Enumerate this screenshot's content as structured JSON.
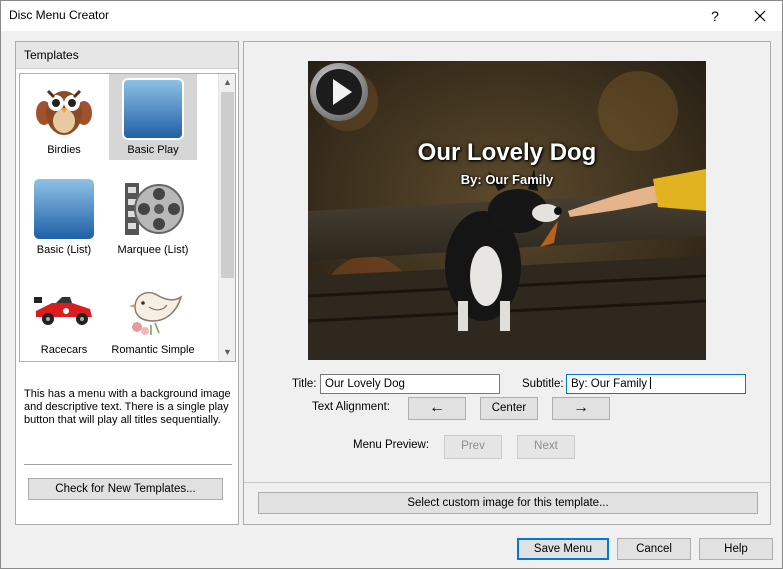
{
  "window": {
    "title": "Disc Menu Creator",
    "help_glyph": "?"
  },
  "templates": {
    "header": "Templates",
    "items": [
      {
        "label": "Birdies",
        "icon": "owl-icon",
        "selected": false
      },
      {
        "label": "Basic Play",
        "icon": "blue-gradient-icon",
        "selected": true
      },
      {
        "label": "Basic (List)",
        "icon": "blue-gradient-icon",
        "selected": false
      },
      {
        "label": "Marquee (List)",
        "icon": "film-reel-icon",
        "selected": false
      },
      {
        "label": "Racecars",
        "icon": "race-car-icon",
        "selected": false
      },
      {
        "label": "Romantic Simple",
        "icon": "bird-with-flowers-icon",
        "selected": false
      }
    ],
    "description": "This has a menu with a background image and descriptive text. There is a single play button that will play all titles sequentially.",
    "check_button": "Check for New Templates..."
  },
  "preview": {
    "title": "Our Lovely Dog",
    "subtitle": "By: Our Family"
  },
  "form": {
    "title_label": "Title:",
    "title_value": "Our Lovely Dog",
    "subtitle_label": "Subtitle:",
    "subtitle_value": "By: Our Family",
    "alignment_label": "Text Alignment:",
    "align_left_glyph": "←",
    "align_center": "Center",
    "align_right_glyph": "→",
    "menu_preview_label": "Menu Preview:",
    "prev": "Prev",
    "next": "Next",
    "custom_image_button": "Select custom image for this template..."
  },
  "footer": {
    "save": "Save Menu",
    "cancel": "Cancel",
    "help": "Help"
  },
  "colors": {
    "accent": "#0078d7",
    "selected_bg": "#d6d6d6",
    "button_bg": "#e1e1e1"
  }
}
